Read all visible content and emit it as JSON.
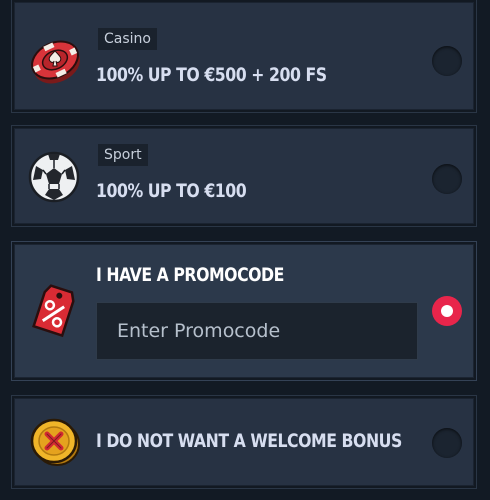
{
  "options": [
    {
      "key": "casino",
      "category": "Casino",
      "title": "100% UP TO €500 + 200 FS",
      "icon": "casino-chip-icon",
      "selected": false
    },
    {
      "key": "sport",
      "category": "Sport",
      "title": "100% UP TO €100",
      "icon": "soccer-ball-icon",
      "selected": false
    },
    {
      "key": "promocode",
      "title": "I HAVE A PROMOCODE",
      "icon": "percent-tag-icon",
      "input_placeholder": "Enter Promocode",
      "input_value": "",
      "selected": true
    },
    {
      "key": "no-bonus",
      "title": "I DO NOT WANT A WELCOME BONUS",
      "icon": "cross-coin-icon",
      "selected": false
    }
  ],
  "colors": {
    "background": "#121a24",
    "card": "#273243",
    "accent": "#e8254b",
    "text": "#d7def0"
  }
}
